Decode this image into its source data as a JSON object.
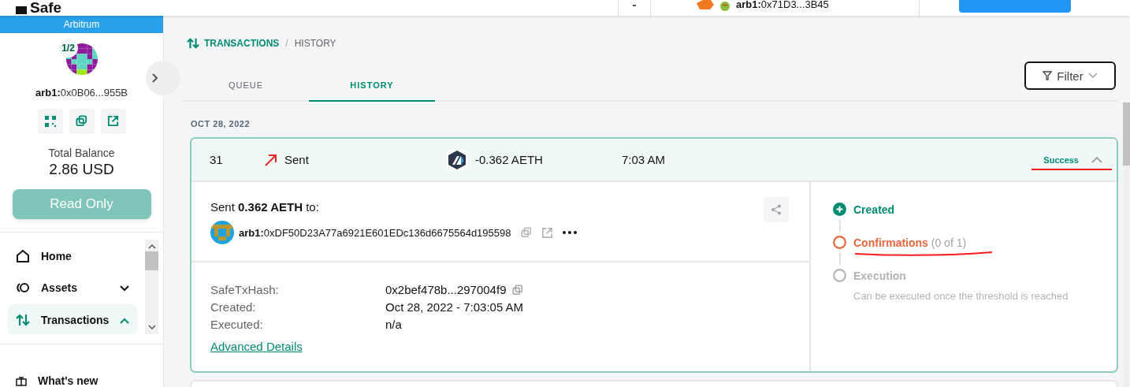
{
  "header": {
    "logo": "Safe",
    "account_prefix": "arb1:",
    "account_address": "0x71D3...3B45"
  },
  "sidebar": {
    "network": "Arbitrum",
    "threshold": "1/2",
    "address_prefix": "arb1:",
    "address": "0x0B06...955B",
    "balance_label": "Total Balance",
    "balance": "2.86 USD",
    "read_only_button": "Read Only",
    "nav": [
      {
        "label": "Home",
        "kind": "link",
        "selected": false
      },
      {
        "label": "Assets",
        "kind": "group",
        "selected": false,
        "expanded": false
      },
      {
        "label": "Transactions",
        "kind": "group",
        "selected": true,
        "expanded": true
      }
    ],
    "footer_item": "What's new"
  },
  "breadcrumb": {
    "section": "TRANSACTIONS",
    "separator": "/",
    "page": "HISTORY"
  },
  "tabs": [
    {
      "label": "QUEUE",
      "selected": false
    },
    {
      "label": "HISTORY",
      "selected": true
    }
  ],
  "filter_button": "Filter",
  "date": "OCT 28, 2022",
  "transaction": {
    "nonce": "31",
    "type": "Sent",
    "amount": "-0.362 AETH",
    "time": "7:03 AM",
    "status": "Success",
    "expanded": true,
    "summary": "Sent **0.362 AETH** to:",
    "recipient_prefix": "arb1:",
    "recipient": "0xDF50D23A77a6921E601EDc136d6675564d195598",
    "details": [
      {
        "label": "SafeTxHash:",
        "value": "0x2bef478b...297004f9",
        "copyable": true
      },
      {
        "label": "Created:",
        "value": "Oct 28, 2022 - 7:03:05 AM",
        "copyable": false
      },
      {
        "label": "Executed:",
        "value": "n/a",
        "copyable": false
      }
    ],
    "advanced_link": "Advanced Details",
    "steps": [
      {
        "label": "Created",
        "kind": "done"
      },
      {
        "label": "Confirmations",
        "note": "(0 of 1)",
        "kind": "active"
      },
      {
        "label": "Execution",
        "kind": "pending",
        "hint": "Can be executed once the threshold is reached"
      }
    ]
  }
}
